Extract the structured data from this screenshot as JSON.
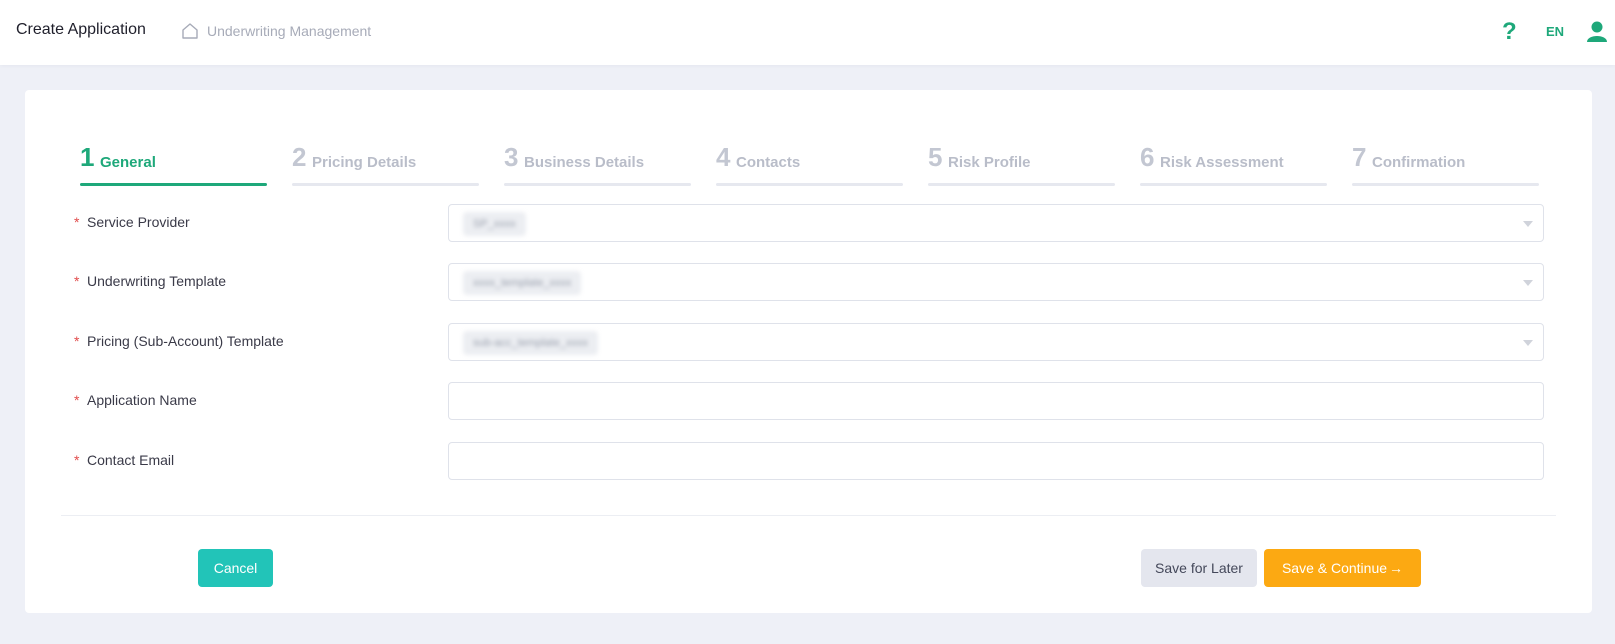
{
  "header": {
    "title": "Create Application",
    "breadcrumb": "Underwriting Management",
    "help_symbol": "?",
    "language": "EN",
    "colors": {
      "accent": "#1ea87a"
    }
  },
  "steps": [
    {
      "num": "1",
      "label": "General",
      "active": true
    },
    {
      "num": "2",
      "label": "Pricing Details",
      "active": false
    },
    {
      "num": "3",
      "label": "Business Details",
      "active": false
    },
    {
      "num": "4",
      "label": "Contacts",
      "active": false
    },
    {
      "num": "5",
      "label": "Risk Profile",
      "active": false
    },
    {
      "num": "6",
      "label": "Risk Assessment",
      "active": false
    },
    {
      "num": "7",
      "label": "Confirmation",
      "active": false
    }
  ],
  "form": {
    "required_mark": "*",
    "service_provider": {
      "label": "Service Provider",
      "value": "SP_xxxx"
    },
    "underwriting_template": {
      "label": "Underwriting Template",
      "value": "xxxx_template_xxxx"
    },
    "pricing_template": {
      "label": "Pricing (Sub-Account) Template",
      "value": "sub-acc_template_xxxx"
    },
    "application_name": {
      "label": "Application Name",
      "value": ""
    },
    "contact_email": {
      "label": "Contact Email",
      "value": ""
    }
  },
  "actions": {
    "cancel": "Cancel",
    "save_later": "Save for Later",
    "save_continue": "Save & Continue",
    "continue_arrow": "→",
    "colors": {
      "cancel": "#22c4b8",
      "continue": "#fca912",
      "later": "#e4e6ee"
    }
  }
}
